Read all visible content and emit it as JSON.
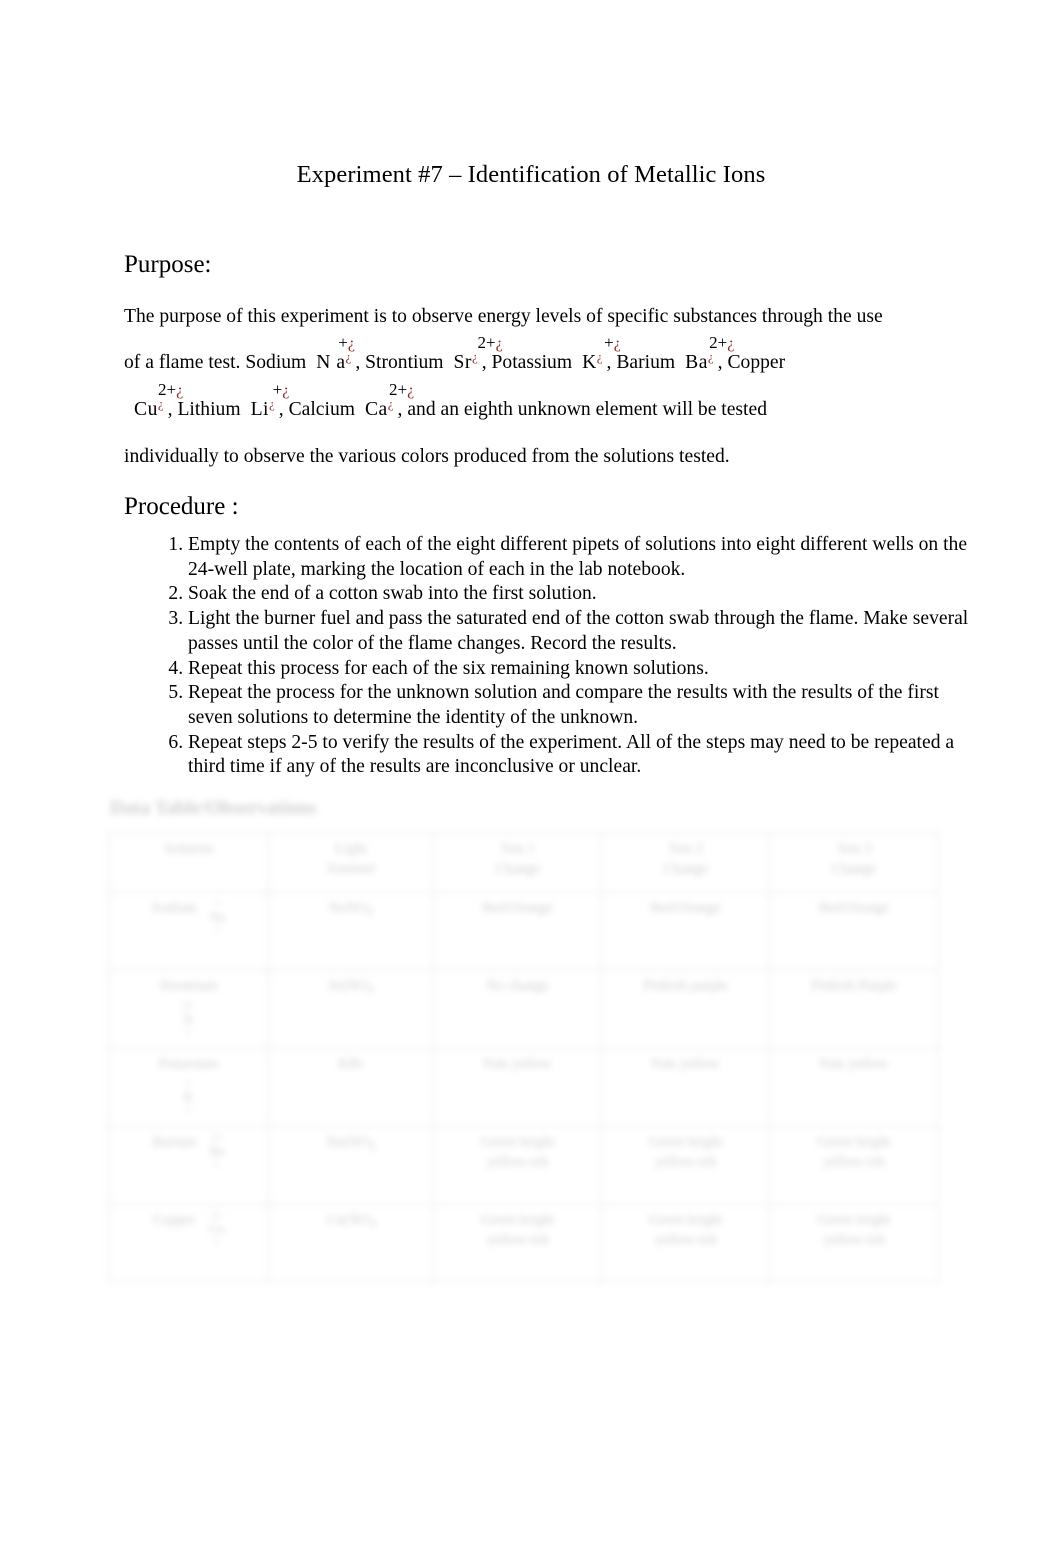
{
  "document": {
    "title": "Experiment #7 – Identification of Metallic Ions"
  },
  "purpose": {
    "heading": "Purpose:",
    "line1": "The purpose of this experiment is to observe energy levels of specific substances through the use",
    "line2_a": "of a flame test. Sodium",
    "line2_b": ", Strontium",
    "line2_c": ", Potassium",
    "line2_d": ", Barium",
    "line2_e": ", Copper",
    "line3_a": ", Lithium",
    "line3_b": ", Calcium",
    "line3_c": ", and an eighth unknown element will be tested",
    "line4": "individually to observe the various colors produced from the solutions tested.",
    "ions": {
      "sodium": {
        "symbol": "N a",
        "charge": "+",
        "placeholder": "¿",
        "tail": "¿"
      },
      "strontium": {
        "symbol": "Sr",
        "charge": "2+",
        "placeholder": "¿",
        "tail": "¿"
      },
      "potassium": {
        "symbol": "K",
        "charge": "+",
        "placeholder": "¿",
        "tail": "¿"
      },
      "barium": {
        "symbol": "Ba",
        "charge": "2+",
        "placeholder": "¿",
        "tail": "¿"
      },
      "copper": {
        "symbol": "Cu",
        "charge": "2+",
        "placeholder": "¿",
        "tail": "¿"
      },
      "lithium": {
        "symbol": "Li",
        "charge": "+",
        "placeholder": "¿",
        "tail": "¿"
      },
      "calcium": {
        "symbol": "Ca",
        "charge": "2+",
        "placeholder": "¿",
        "tail": "¿"
      }
    }
  },
  "procedure": {
    "heading": "Procedure :",
    "steps": [
      "Empty the contents of each of the eight different pipets of solutions into eight different wells on the 24-well plate, marking the location of each in the lab notebook.",
      "Soak the end of a cotton swab into the first solution.",
      "Light the burner fuel and pass the saturated end of the cotton swab through the flame. Make several passes until the color of the flame changes. Record the results.",
      "Repeat this process for each of the six remaining known solutions.",
      "Repeat the process for the unknown solution and compare the results with the results of the first seven solutions to determine the identity of the unknown.",
      "Repeat steps 2-5 to verify the results of the experiment. All of the steps may need to be repeated a third time if any of the results are inconclusive or unclear."
    ]
  },
  "data_table": {
    "title": "Data Table/Observations",
    "headers": [
      {
        "line1": "Solution",
        "line2": ""
      },
      {
        "line1": "Light",
        "line2": "Emitted"
      },
      {
        "line1": "Test 1",
        "line2": "Change"
      },
      {
        "line1": "Test 2",
        "line2": "Change"
      },
      {
        "line1": "Test 3",
        "line2": "Change"
      }
    ],
    "rows": [
      {
        "element": "Sodium",
        "ion": {
          "charge": "+",
          "symbol": "Na",
          "tail": "¿"
        },
        "ion_layout": "inline",
        "formula": "NaNO",
        "formula_sub": "3",
        "test1": {
          "line1": "Red/Orange",
          "line2": ""
        },
        "test2": {
          "line1": "Red/Orange",
          "line2": ""
        },
        "test3": {
          "line1": "Red/Orange",
          "line2": ""
        }
      },
      {
        "element": "Strontium",
        "ion": {
          "charge": "2+",
          "symbol": "Sr",
          "tail": "¿"
        },
        "ion_layout": "stacked",
        "formula": "Sr(NO",
        "formula_sub": "3",
        "test1": {
          "line1": "No change",
          "line2": ""
        },
        "test2": {
          "line1": "Pinkish purple",
          "line2": ""
        },
        "test3": {
          "line1": "Pinkish Purple",
          "line2": ""
        }
      },
      {
        "element": "Potassium",
        "ion": {
          "charge": "+",
          "symbol": "K",
          "tail": "¿"
        },
        "ion_layout": "stacked",
        "formula": "KBr",
        "formula_sub": "",
        "test1": {
          "line1": "Pale yellow",
          "line2": ""
        },
        "test2": {
          "line1": "Pale yellow",
          "line2": ""
        },
        "test3": {
          "line1": "Pale yellow",
          "line2": ""
        }
      },
      {
        "element": "Barium",
        "ion": {
          "charge": "2+",
          "symbol": "Ba",
          "tail": "¿"
        },
        "ion_layout": "inline",
        "formula": "Ba(NO",
        "formula_sub": "3",
        "test1": {
          "line1": "Green bright",
          "line2": "yellow-ish"
        },
        "test2": {
          "line1": "Green bright",
          "line2": "yellow-ish"
        },
        "test3": {
          "line1": "Green bright",
          "line2": "yellow-ish"
        }
      },
      {
        "element": "Copper",
        "ion": {
          "charge": "2+",
          "symbol": "Cu",
          "tail": "¿"
        },
        "ion_layout": "inline",
        "formula": "Cu(NO",
        "formula_sub": "3",
        "test1": {
          "line1": "Green bright",
          "line2": "yellow-ish"
        },
        "test2": {
          "line1": "Green bright",
          "line2": "yellow-ish"
        },
        "test3": {
          "line1": "Green bright",
          "line2": "yellow-ish"
        }
      }
    ]
  },
  "colors": {
    "text": "#000000",
    "formula_artifact": "#8c2a20",
    "table_border": "#c9c9c9",
    "faded_text": "#3f3f3f"
  }
}
